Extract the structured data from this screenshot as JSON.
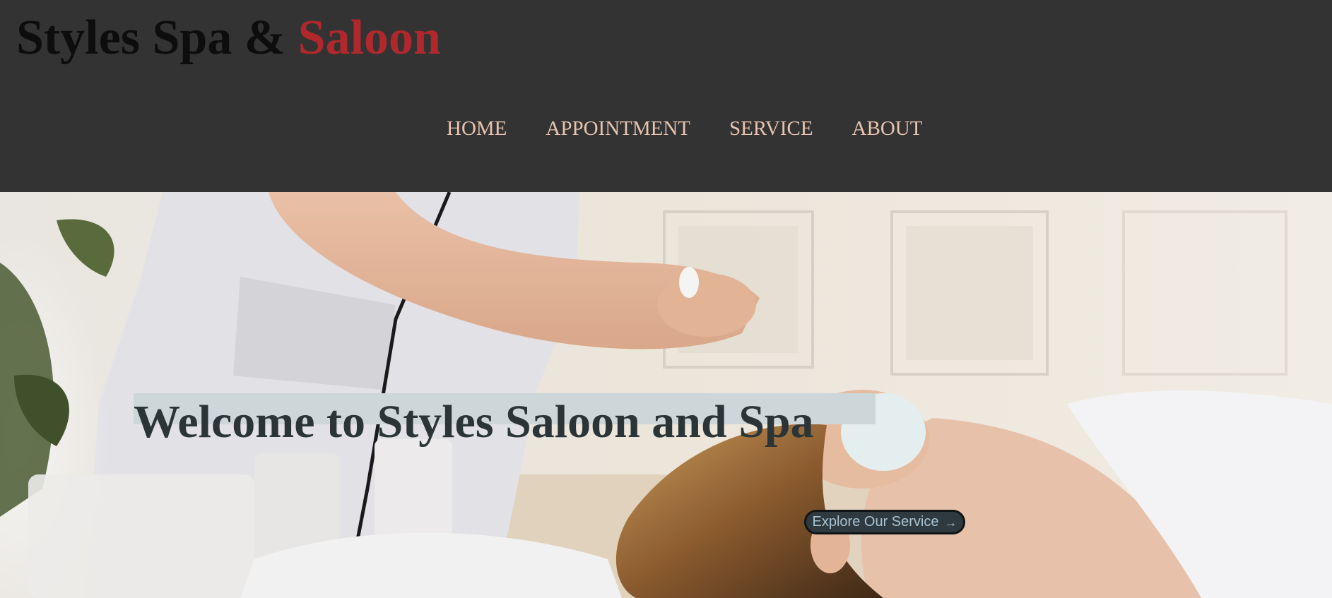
{
  "brand": {
    "part1": "Styles Spa & ",
    "part2": "Saloon"
  },
  "nav": {
    "items": [
      {
        "label": "HOME"
      },
      {
        "label": "APPOINTMENT"
      },
      {
        "label": "SERVICE"
      },
      {
        "label": "ABOUT"
      }
    ]
  },
  "hero": {
    "headline": "Welcome to Styles Saloon and Spa",
    "cta_label": "Explore Our Service",
    "cta_icon": "arrow-right-icon"
  },
  "colors": {
    "header_bg": "#333333",
    "brand_dark": "#0d0d0d",
    "brand_accent": "#b0282c",
    "nav_text": "#e8c4b0",
    "headline": "#2b3538"
  }
}
